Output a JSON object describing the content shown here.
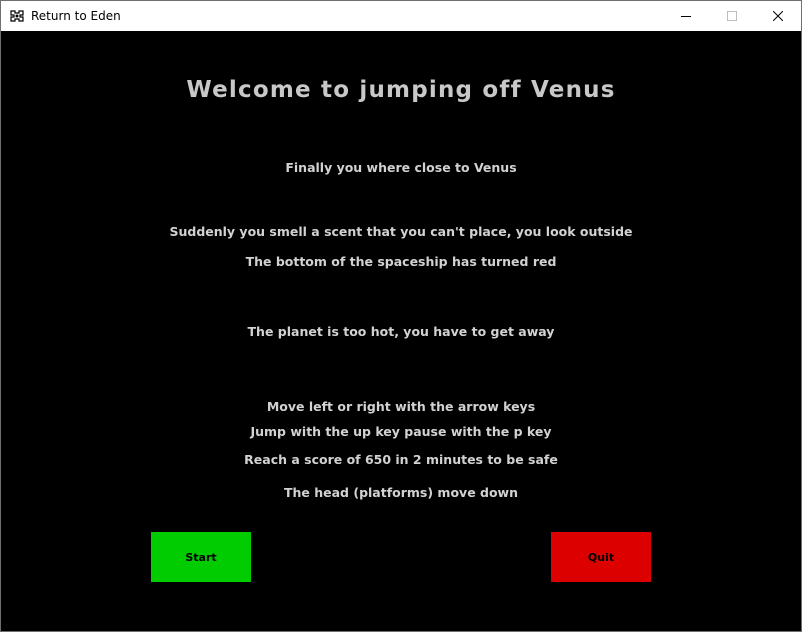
{
  "window": {
    "title": "Return to Eden",
    "icon": "game-controller-icon"
  },
  "controls": {
    "minimize_icon": "minimize-icon",
    "maximize_icon": "maximize-icon",
    "close_icon": "close-icon"
  },
  "intro": {
    "heading": "Welcome to jumping off Venus",
    "lines": [
      "Finally you where close to Venus",
      "Suddenly you smell a scent that you can't place, you look outside",
      "The bottom of the spaceship has turned red",
      "The planet is too hot, you have to get away",
      "Move left or right with the arrow keys",
      "Jump with the up key pause with the p key",
      "Reach a score of 650 in 2 minutes to be safe",
      "The head (platforms) move down"
    ]
  },
  "buttons": {
    "start_label": "Start",
    "quit_label": "Quit",
    "start_color": "#00cc00",
    "quit_color": "#dd0000"
  },
  "colors": {
    "background": "#000000",
    "text": "#d2d2d2"
  }
}
